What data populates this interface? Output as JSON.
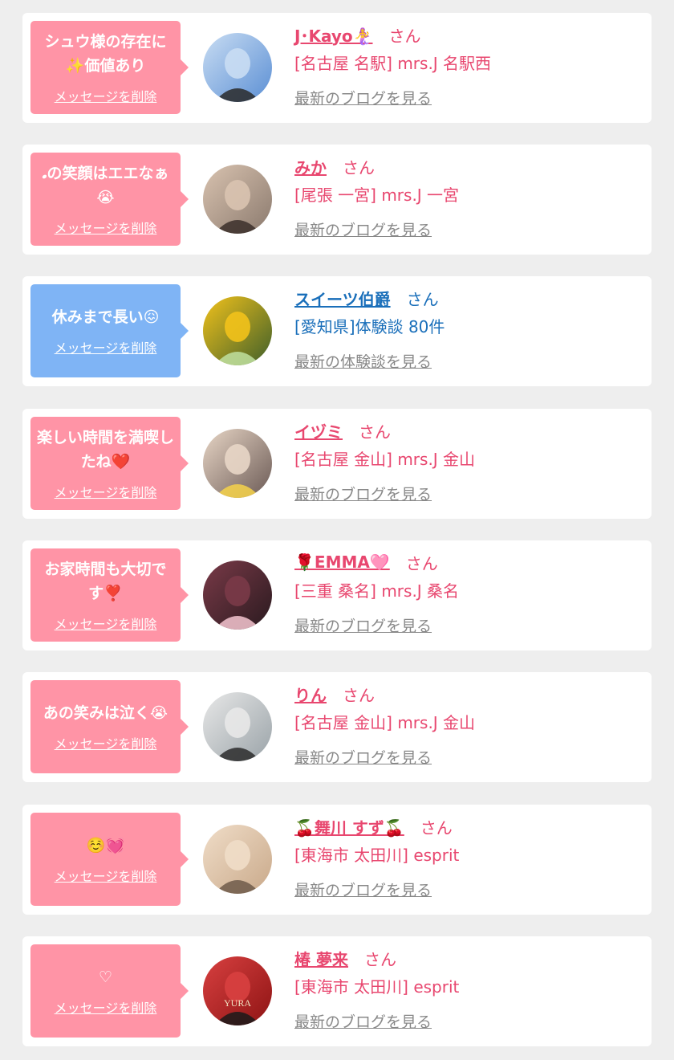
{
  "common": {
    "delete_label": "メッセージを削除",
    "san_label": "さん"
  },
  "colors": {
    "pink_bubble": "#ff94a6",
    "blue_bubble": "#7fb4f5",
    "pink_text": "#e8476f",
    "blue_text": "#1a6fba",
    "link_gray": "#888888"
  },
  "messages": [
    {
      "theme": "pink",
      "bubble": "シュウ様の存在に✨価値あり",
      "name": "J･Kayo🧜‍♀️",
      "shop": "[名古屋 名駅] mrs.J 名駅西",
      "link": "最新のブログを見る",
      "avatar_icon": "tower-photo-icon",
      "avatar_colors": [
        "#5b8fd4",
        "#c9ddf3",
        "#2a2a2a"
      ]
    },
    {
      "theme": "pink",
      "bubble": "𝅘の笑顔はエエなぁ😭",
      "name": "みか",
      "shop": "[尾張 一宮] mrs.J 一宮",
      "link": "最新のブログを見る",
      "avatar_icon": "selfie-photo-icon",
      "avatar_colors": [
        "#8b7a6e",
        "#d9c3b0",
        "#3b2f2a"
      ]
    },
    {
      "theme": "blue",
      "bubble": "休みまで長い😖",
      "name": "スイーツ伯爵",
      "shop": "[愛知県]体験談 80件",
      "link": "最新の体験談を見る",
      "avatar_icon": "flower-photo-icon",
      "avatar_colors": [
        "#3f5f2a",
        "#f2c21b",
        "#c0e0a0"
      ]
    },
    {
      "theme": "pink",
      "bubble": "楽しい時間を満喫したね❤️",
      "name": "イヅミ",
      "shop": "[名古屋 金山] mrs.J 金山",
      "link": "最新のブログを見る",
      "avatar_icon": "star-face-photo-icon",
      "avatar_colors": [
        "#6b5a55",
        "#e8d6c6",
        "#f6d24a"
      ]
    },
    {
      "theme": "pink",
      "bubble": "お家時間も大切です❣️",
      "name": "🌹EMMA🩷",
      "shop": "[三重 桑名] mrs.J 桑名",
      "link": "最新のブログを見る",
      "avatar_icon": "portrait-photo-icon",
      "avatar_colors": [
        "#2a1a1f",
        "#7a3a48",
        "#f4c6d0"
      ]
    },
    {
      "theme": "pink",
      "bubble": "あの笑みは泣く😭",
      "name": "りん",
      "shop": "[名古屋 金山] mrs.J 金山",
      "link": "最新のブログを見る",
      "avatar_icon": "masked-face-photo-icon",
      "avatar_colors": [
        "#9aa3a8",
        "#e8e8e8",
        "#2b2b2b"
      ]
    },
    {
      "theme": "pink",
      "bubble": "☺️💓",
      "name": "🍒舞川 すず🍒",
      "shop": "[東海市 太田川] esprit",
      "link": "最新のブログを見る",
      "avatar_icon": "kimono-photo-icon",
      "avatar_colors": [
        "#c9a98a",
        "#f0ddc8",
        "#6e5a4a"
      ]
    },
    {
      "theme": "pink",
      "bubble": "♡",
      "name": "椿 夢来",
      "shop": "[東海市 太田川] esprit",
      "link": "最新のブログを見る",
      "avatar_icon": "birthday-photo-icon",
      "avatar_colors": [
        "#8e1414",
        "#d84040",
        "#1a1a1a"
      ],
      "avatar_caption": "YURA"
    }
  ]
}
